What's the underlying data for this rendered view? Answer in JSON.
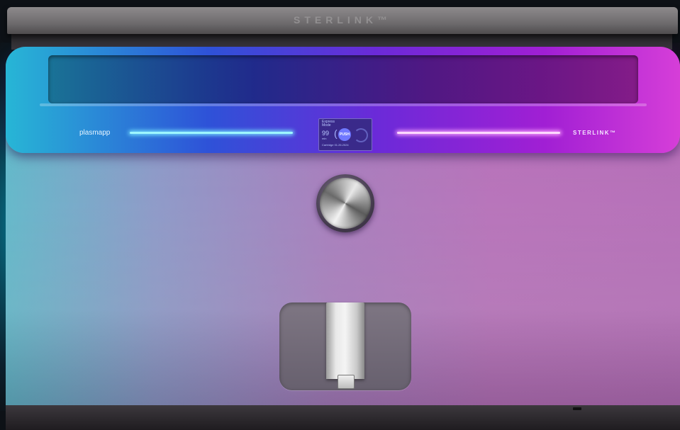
{
  "product": {
    "lid_brand": "STERLINK™",
    "left_logo": "plasmapp",
    "right_logo": "STERLINK™"
  },
  "display": {
    "mode_label": "Express Mode",
    "value": "99",
    "unit": "min",
    "button_label": "PUSH",
    "footer": "Cartridge 01.26.2024"
  },
  "colors": {
    "glow_left": "#27b6d6",
    "glow_mid": "#6b2ad8",
    "glow_right": "#d63ed8"
  }
}
